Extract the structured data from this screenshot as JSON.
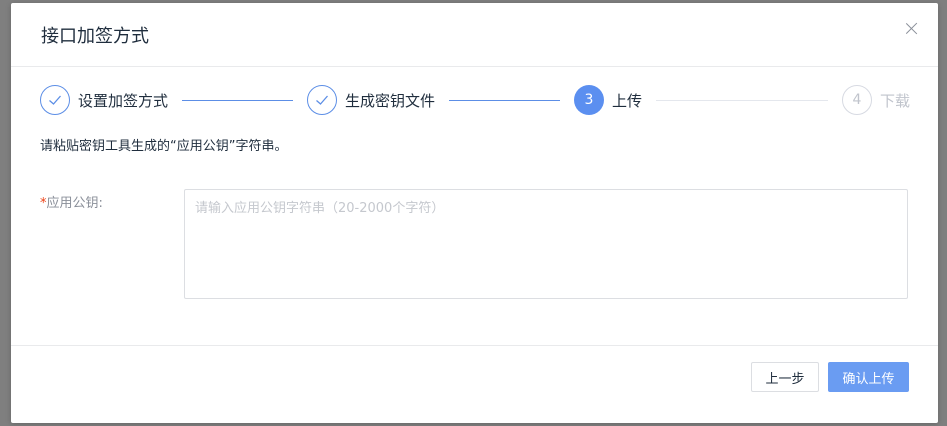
{
  "modal": {
    "title": "接口加签方式"
  },
  "steps": [
    {
      "number": "1",
      "label": "设置加签方式",
      "status": "done"
    },
    {
      "number": "2",
      "label": "生成密钥文件",
      "status": "done"
    },
    {
      "number": "3",
      "label": "上传",
      "status": "active"
    },
    {
      "number": "4",
      "label": "下载",
      "status": "pending"
    }
  ],
  "hint": "请粘贴密钥工具生成的“应用公钥”字符串。",
  "form": {
    "required_mark": "*",
    "label": "应用公钥:",
    "value": "",
    "placeholder": "请输入应用公钥字符串（20-2000个字符）"
  },
  "footer": {
    "prev_label": "上一步",
    "confirm_label": "确认上传"
  },
  "colors": {
    "accent": "#5b8ff0",
    "confirm_button": "#6a9cf2",
    "required": "#ed4014"
  }
}
